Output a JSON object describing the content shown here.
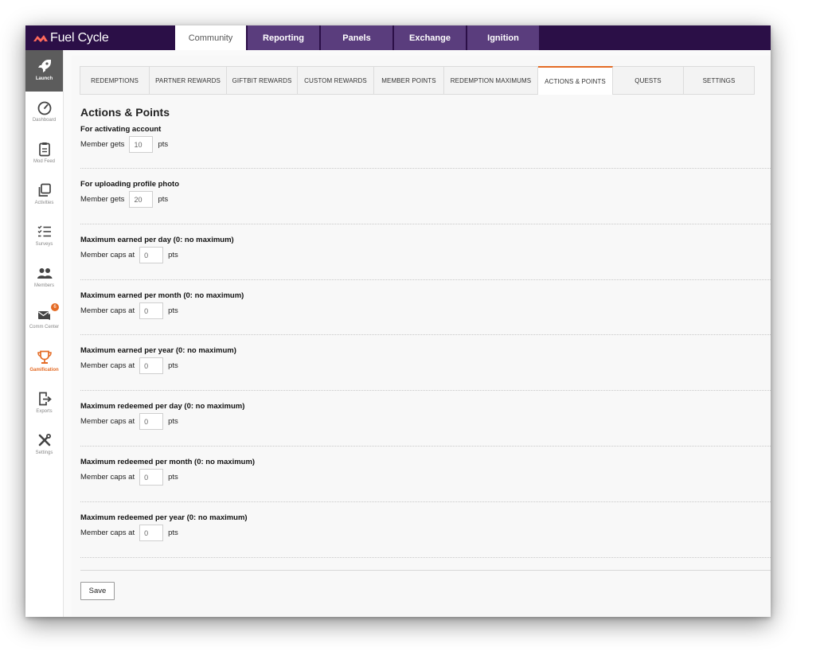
{
  "brand": {
    "name": "Fuel Cycle"
  },
  "top_nav": [
    {
      "label": "Community",
      "active": true
    },
    {
      "label": "Reporting",
      "active": false
    },
    {
      "label": "Panels",
      "active": false
    },
    {
      "label": "Exchange",
      "active": false
    },
    {
      "label": "Ignition",
      "active": false
    }
  ],
  "sidebar": {
    "items": [
      {
        "label": "Launch",
        "icon": "rocket-icon"
      },
      {
        "label": "Dashboard",
        "icon": "gauge-icon"
      },
      {
        "label": "Mod Feed",
        "icon": "clipboard-icon"
      },
      {
        "label": "Activities",
        "icon": "copy-icon"
      },
      {
        "label": "Surveys",
        "icon": "checklist-icon"
      },
      {
        "label": "Members",
        "icon": "members-icon"
      },
      {
        "label": "Comm Center",
        "icon": "comm-center-icon",
        "badge": "6"
      },
      {
        "label": "Gamification",
        "icon": "trophy-icon"
      },
      {
        "label": "Exports",
        "icon": "export-icon"
      },
      {
        "label": "Settings",
        "icon": "tools-icon"
      }
    ]
  },
  "sub_tabs": [
    {
      "label": "REDEMPTIONS",
      "active": false
    },
    {
      "label": "PARTNER REWARDS",
      "active": false
    },
    {
      "label": "GIFTBIT REWARDS",
      "active": false
    },
    {
      "label": "CUSTOM REWARDS",
      "active": false
    },
    {
      "label": "MEMBER POINTS",
      "active": false
    },
    {
      "label": "REDEMPTION MAXIMUMS",
      "active": false
    },
    {
      "label": "ACTIONS & POINTS",
      "active": true
    },
    {
      "label": "QUESTS",
      "active": false
    },
    {
      "label": "SETTINGS",
      "active": false
    }
  ],
  "page": {
    "title": "Actions & Points",
    "sections": [
      {
        "title": "For activating account",
        "prefix": "Member gets",
        "value": "10",
        "suffix": "pts"
      },
      {
        "title": "For uploading profile photo",
        "prefix": "Member gets",
        "value": "20",
        "suffix": "pts"
      },
      {
        "title": "Maximum earned per day (0: no maximum)",
        "prefix": "Member caps at",
        "value": "0",
        "suffix": "pts"
      },
      {
        "title": "Maximum earned per month (0: no maximum)",
        "prefix": "Member caps at",
        "value": "0",
        "suffix": "pts"
      },
      {
        "title": "Maximum earned per year (0: no maximum)",
        "prefix": "Member caps at",
        "value": "0",
        "suffix": "pts"
      },
      {
        "title": "Maximum redeemed per day (0: no maximum)",
        "prefix": "Member caps at",
        "value": "0",
        "suffix": "pts"
      },
      {
        "title": "Maximum redeemed per month (0: no maximum)",
        "prefix": "Member caps at",
        "value": "0",
        "suffix": "pts"
      },
      {
        "title": "Maximum redeemed per year (0: no maximum)",
        "prefix": "Member caps at",
        "value": "0",
        "suffix": "pts"
      }
    ],
    "save_label": "Save"
  },
  "colors": {
    "topbar": "#2b0f47",
    "nav_tab": "#5a3d7d",
    "accent": "#e46b25"
  }
}
